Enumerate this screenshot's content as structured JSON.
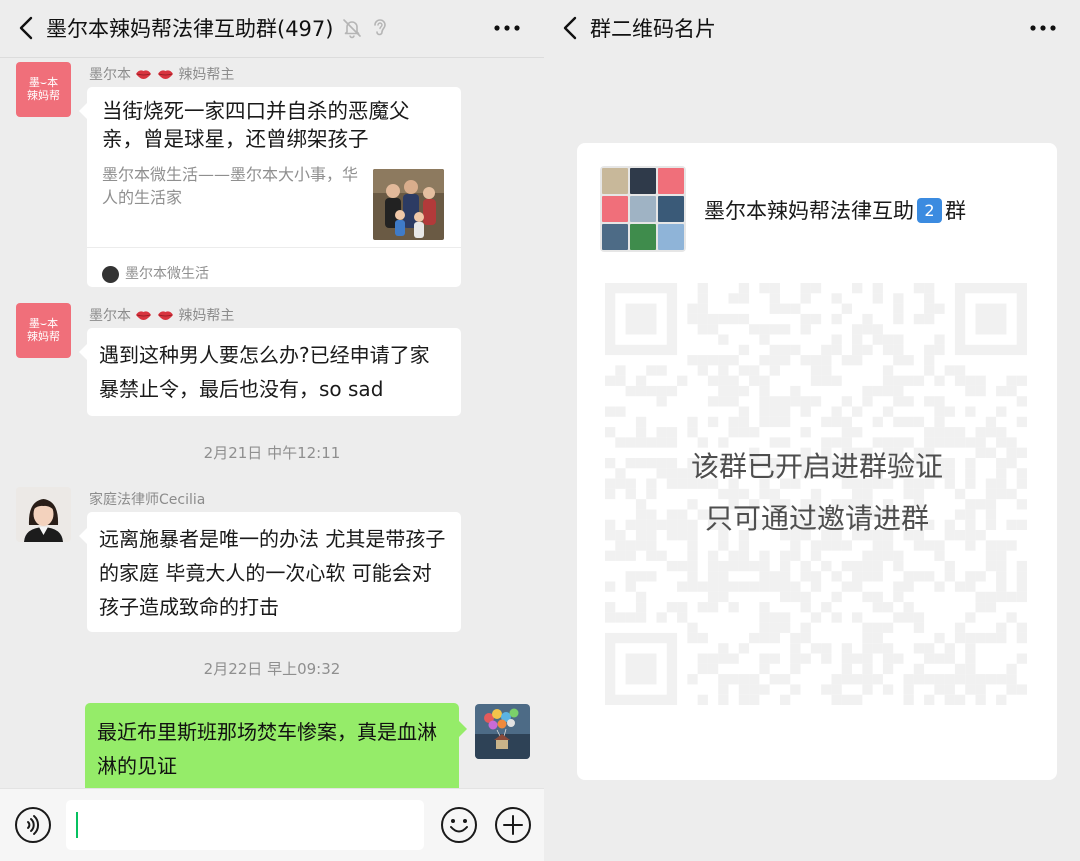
{
  "chat": {
    "title": "墨尔本辣妈帮法律互助群(497)",
    "messages": [
      {
        "avatar_text_top": "墨⌣本",
        "avatar_text_bottom": "辣妈帮",
        "sender_name": "墨尔本",
        "sender_suffix": "辣妈帮主",
        "card_title": "当街烧死一家四口并自杀的恶魔父亲，曾是球星，还曾绑架孩子",
        "card_desc": "墨尔本微生活——墨尔本大小事，华人的生活家",
        "card_source": "墨尔本微生活"
      },
      {
        "avatar_text_top": "墨⌣本",
        "avatar_text_bottom": "辣妈帮",
        "sender_name": "墨尔本",
        "sender_suffix": "辣妈帮主",
        "text": "遇到这种男人要怎么办?已经申请了家暴禁止令，最后也没有，so sad"
      },
      {
        "sender_name": "家庭法律师Cecilia",
        "text": "远离施暴者是唯一的办法 尤其是带孩子的家庭 毕竟大人的一次心软 可能会对孩子造成致命的打击"
      },
      {
        "text": "最近布里斯班那场焚车惨案，真是血淋淋的见证"
      }
    ],
    "timestamps": [
      "2月21日 中午12:11",
      "2月22日 早上09:32"
    ],
    "input": {
      "value": ""
    }
  },
  "qr_page": {
    "title": "群二维码名片",
    "group_name_prefix": "墨尔本辣妈帮法律互助",
    "group_number": "2",
    "group_name_suffix": "群",
    "notice_line1": "该群已开启进群验证",
    "notice_line2": "只可通过邀请进群"
  },
  "icons": {
    "back": "chevron-left-icon",
    "mute": "bell-off-icon",
    "earpiece": "ear-icon",
    "more": "more-dots-icon",
    "voice": "voice-icon",
    "emoji": "emoji-icon",
    "plus": "plus-icon"
  },
  "colors": {
    "page_bg": "#ededed",
    "my_bubble": "#95ec69",
    "other_bubble": "#ffffff",
    "avatar_pink": "#f06f7a",
    "caret": "#07c160"
  }
}
